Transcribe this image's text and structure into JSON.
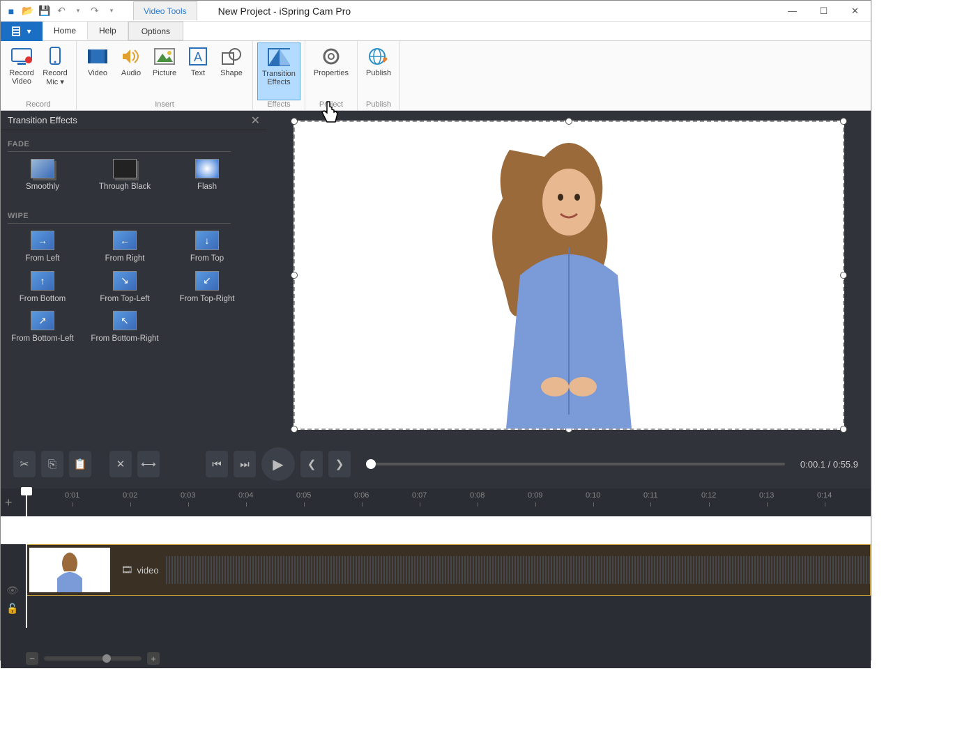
{
  "window": {
    "title": "New Project - iSpring Cam Pro",
    "tool_tab": "Video Tools"
  },
  "ribbon_tabs": {
    "file": "",
    "home": "Home",
    "help": "Help",
    "options": "Options"
  },
  "ribbon": {
    "record": {
      "record_video": "Record\nVideo",
      "record_mic": "Record\nMic",
      "group": "Record"
    },
    "insert": {
      "video": "Video",
      "audio": "Audio",
      "picture": "Picture",
      "text": "Text",
      "shape": "Shape",
      "group": "Insert"
    },
    "effects": {
      "transition": "Transition\nEffects",
      "group": "Effects"
    },
    "project": {
      "properties": "Properties",
      "group": "Project"
    },
    "publish": {
      "publish": "Publish",
      "group": "Publish"
    }
  },
  "side_panel": {
    "title": "Transition Effects",
    "fade": {
      "header": "FADE",
      "items": [
        "Smoothly",
        "Through Black",
        "Flash"
      ]
    },
    "wipe": {
      "header": "WIPE",
      "items": [
        "From Left",
        "From Right",
        "From Top",
        "From Bottom",
        "From Top-Left",
        "From Top-Right",
        "From Bottom-Left",
        "From Bottom-Right"
      ]
    }
  },
  "player": {
    "time": "0:00.1 / 0:55.9"
  },
  "ruler": {
    "marks": [
      "0:01",
      "0:02",
      "0:03",
      "0:04",
      "0:05",
      "0:06",
      "0:07",
      "0:08",
      "0:09",
      "0:10",
      "0:11",
      "0:12",
      "0:13",
      "0:14"
    ]
  },
  "timeline": {
    "clip_label": "video"
  }
}
